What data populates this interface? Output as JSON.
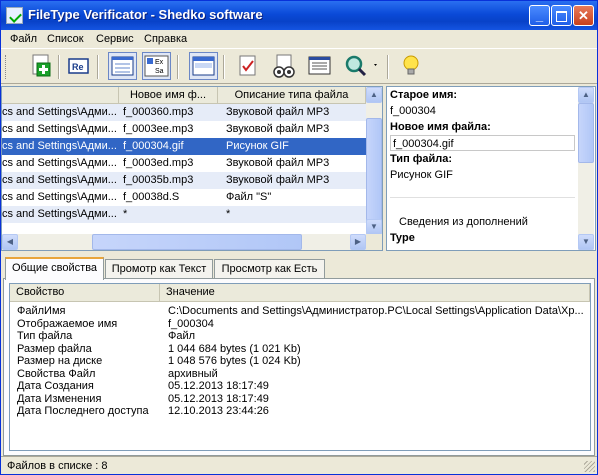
{
  "window": {
    "title": "FileType Verificator - Shedko software"
  },
  "menu": [
    "Файл",
    "Список",
    "Сервис",
    "Справка"
  ],
  "toolbar": [
    {
      "name": "add-files-icon"
    },
    {
      "name": "rename-icon"
    },
    {
      "name": "view-list-icon"
    },
    {
      "name": "view-details-icon"
    },
    {
      "name": "view-panel-icon"
    },
    {
      "name": "check-icon"
    },
    {
      "name": "scan-icon"
    },
    {
      "name": "info-icon"
    },
    {
      "name": "search-icon"
    },
    {
      "name": "tip-icon"
    }
  ],
  "file_list": {
    "columns": [
      "",
      "Новое имя ф...",
      "Описание типа файла"
    ],
    "rows": [
      {
        "path": "cs and Settings\\Адми...",
        "name": "f_000360.mp3",
        "type": "Звуковой файл MP3"
      },
      {
        "path": "cs and Settings\\Адми...",
        "name": "f_0003ee.mp3",
        "type": "Звуковой файл MP3"
      },
      {
        "path": "cs and Settings\\Адми...",
        "name": "f_000304.gif",
        "type": "Рисунок GIF"
      },
      {
        "path": "cs and Settings\\Адми...",
        "name": "f_0003ed.mp3",
        "type": "Звуковой файл MP3"
      },
      {
        "path": "cs and Settings\\Адми...",
        "name": "f_00035b.mp3",
        "type": "Звуковой файл MP3"
      },
      {
        "path": "cs and Settings\\Адми...",
        "name": "f_00038d.S",
        "type": "Файл \"S\""
      },
      {
        "path": "cs and Settings\\Адми...",
        "name": "*",
        "type": "*"
      }
    ]
  },
  "details": {
    "old_name_label": "Старое имя:",
    "old_name": "f_000304",
    "new_name_label": "Новое имя файла:",
    "new_name": "f_000304.gif",
    "type_label": "Тип файла:",
    "type": "Рисунок GIF",
    "plugin_info": "Сведения из дополнений",
    "type_header": "Type"
  },
  "tabs": [
    "Общие свойства",
    "Промотр как Текст",
    "Просмотр как Есть"
  ],
  "properties": {
    "columns": [
      "Свойство",
      "Значение"
    ],
    "rows": [
      {
        "k": "ФайлИмя",
        "v": "C:\\Documents and Settings\\Администратор.PC\\Local Settings\\Application Data\\Xp..."
      },
      {
        "k": "Отображаемое имя",
        "v": "f_000304"
      },
      {
        "k": "Тип файла",
        "v": "Файл"
      },
      {
        "k": "Размер файла",
        "v": "1 044 684 bytes (1 021 Kb)"
      },
      {
        "k": "Размер на диске",
        "v": "1 048 576 bytes (1 024 Kb)"
      },
      {
        "k": "Свойства Файл",
        "v": "архивный"
      },
      {
        "k": "Дата Создания",
        "v": "05.12.2013 18:17:49"
      },
      {
        "k": "Дата Изменения",
        "v": "05.12.2013 18:17:49"
      },
      {
        "k": "Дата Последнего доступа",
        "v": "12.10.2013 23:44:26"
      }
    ]
  },
  "status": {
    "text": "Файлов в списке : 8"
  },
  "colors": {
    "selection": "#3166c5",
    "alt_row": "#e6ecf8",
    "title_bar": "#0a4ad8"
  }
}
